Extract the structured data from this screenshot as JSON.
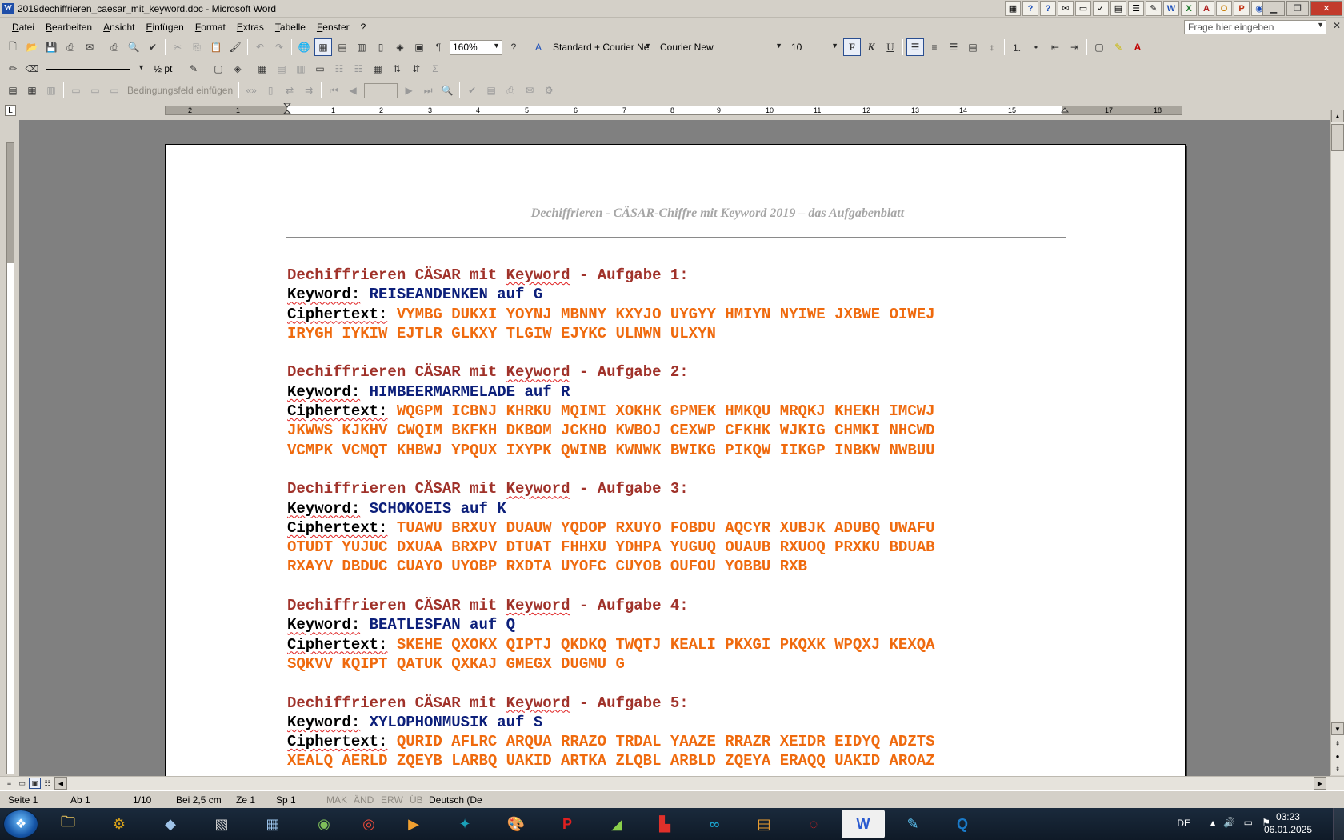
{
  "window": {
    "title": "2019dechiffrieren_caesar_mit_keyword.doc - Microsoft Word",
    "app_icon": "word-icon"
  },
  "menu": {
    "items": [
      "Datei",
      "Bearbeiten",
      "Ansicht",
      "Einfügen",
      "Format",
      "Extras",
      "Tabelle",
      "Fenster",
      "?"
    ],
    "help_placeholder": "Frage hier eingeben"
  },
  "toolbar": {
    "zoom": "160%",
    "style": "Standard + Courier Ne",
    "font": "Courier New",
    "size": "10",
    "bold_label": "F",
    "italic_label": "K",
    "underline_label": "U",
    "line_width": "½ pt",
    "condition_field": "Bedingungsfeld einfügen"
  },
  "ruler": {
    "numbers": [
      "2",
      "1",
      "1",
      "2",
      "3",
      "4",
      "5",
      "6",
      "7",
      "8",
      "9",
      "10",
      "11",
      "12",
      "13",
      "14",
      "15",
      "17",
      "18"
    ]
  },
  "document": {
    "header": "Dechiffrieren - CÄSAR-Chiffre mit Keyword 2019 – das Aufgabenblatt",
    "tasks": [
      {
        "heading_pre": "Dechiffrieren CÄSAR mit ",
        "heading_kw": "Keyword",
        "heading_post": " - Aufgabe 1:",
        "keyword_label": "Keyword:",
        "keyword_value": " REISEANDENKEN auf G",
        "cipher_label": "Ciphertext:",
        "cipher_lines": [
          " VYMBG DUKXI YOYNJ MBNNY KXYJO UYGYY HMIYN NYIWE JXBWE OIWEJ",
          "IRYGH IYKIW EJTLR GLKXY TLGIW EJYKC ULNWN ULXYN"
        ]
      },
      {
        "heading_pre": "Dechiffrieren CÄSAR mit ",
        "heading_kw": "Keyword",
        "heading_post": " - Aufgabe 2:",
        "keyword_label": "Keyword:",
        "keyword_value": " HIMBEERMARMELADE auf R",
        "cipher_label": "Ciphertext:",
        "cipher_lines": [
          " WQGPM ICBNJ KHRKU MQIMI XOKHK GPMEK HMKQU MRQKJ KHEKH IMCWJ",
          "JKWWS KJKHV CWQIM BKFKH DKBOM JCKHO KWBOJ CEXWP CFKHK WJKIG CHMKI NHCWD",
          "VCMPK VCMQT KHBWJ YPQUX IXYPK QWINB KWNWK BWIKG PIKQW IIKGP INBKW NWBUU"
        ]
      },
      {
        "heading_pre": "Dechiffrieren CÄSAR mit ",
        "heading_kw": "Keyword",
        "heading_post": " - Aufgabe 3:",
        "keyword_label": "Keyword:",
        "keyword_value": " SCHOKOEIS auf K",
        "cipher_label": "Ciphertext:",
        "cipher_lines": [
          " TUAWU BRXUY DUAUW YQDOP RXUYO FOBDU AQCYR XUBJK ADUBQ UWAFU",
          "OTUDT YUJUC DXUAA BRXPV DTUAT FHHXU YDHPA YUGUQ OUAUB RXUOQ PRXKU BDUAB",
          "RXAYV DBDUC CUAYO UYOBP RXDTA UYOFC CUYOB OUFOU YOBBU RXB"
        ]
      },
      {
        "heading_pre": "Dechiffrieren CÄSAR mit ",
        "heading_kw": "Keyword",
        "heading_post": " - Aufgabe 4:",
        "keyword_label": "Keyword:",
        "keyword_value": " BEATLESFAN auf Q",
        "cipher_label": "Ciphertext:",
        "cipher_lines": [
          " SKEHE QXOKX QIPTJ QKDKQ TWQTJ KEALI PKXGI PKQXK WPQXJ KEXQA",
          "SQKVV KQIPT QATUK QXKAJ GMEGX DUGMU G"
        ]
      },
      {
        "heading_pre": "Dechiffrieren CÄSAR mit ",
        "heading_kw": "Keyword",
        "heading_post": " - Aufgabe 5:",
        "keyword_label": "Keyword:",
        "keyword_value": " XYLOPHONMUSIK auf S",
        "cipher_label": "Ciphertext:",
        "cipher_lines": [
          " QURID AFLRC ARQUA RRAZO TRDAL YAAZE RRAZR XEIDR EIDYQ ADZTS",
          "XEALQ AERLD ZQEYB LARBQ UAKID ARTKA ZLQBL ARBLD ZQEYA ERAQQ UAKID AROAZ"
        ]
      }
    ]
  },
  "status": {
    "page": "Seite 1",
    "section": "Ab 1",
    "pages": "1/10",
    "at": "Bei 2,5 cm",
    "line": "Ze 1",
    "col": "Sp 1",
    "rec": "MAK",
    "trk": "ÄND",
    "ext": "ERW",
    "ovr": "ÜB",
    "language": "Deutsch (De"
  },
  "taskbar": {
    "lang": "DE",
    "time": "03:23",
    "date": "06.01.2025"
  }
}
